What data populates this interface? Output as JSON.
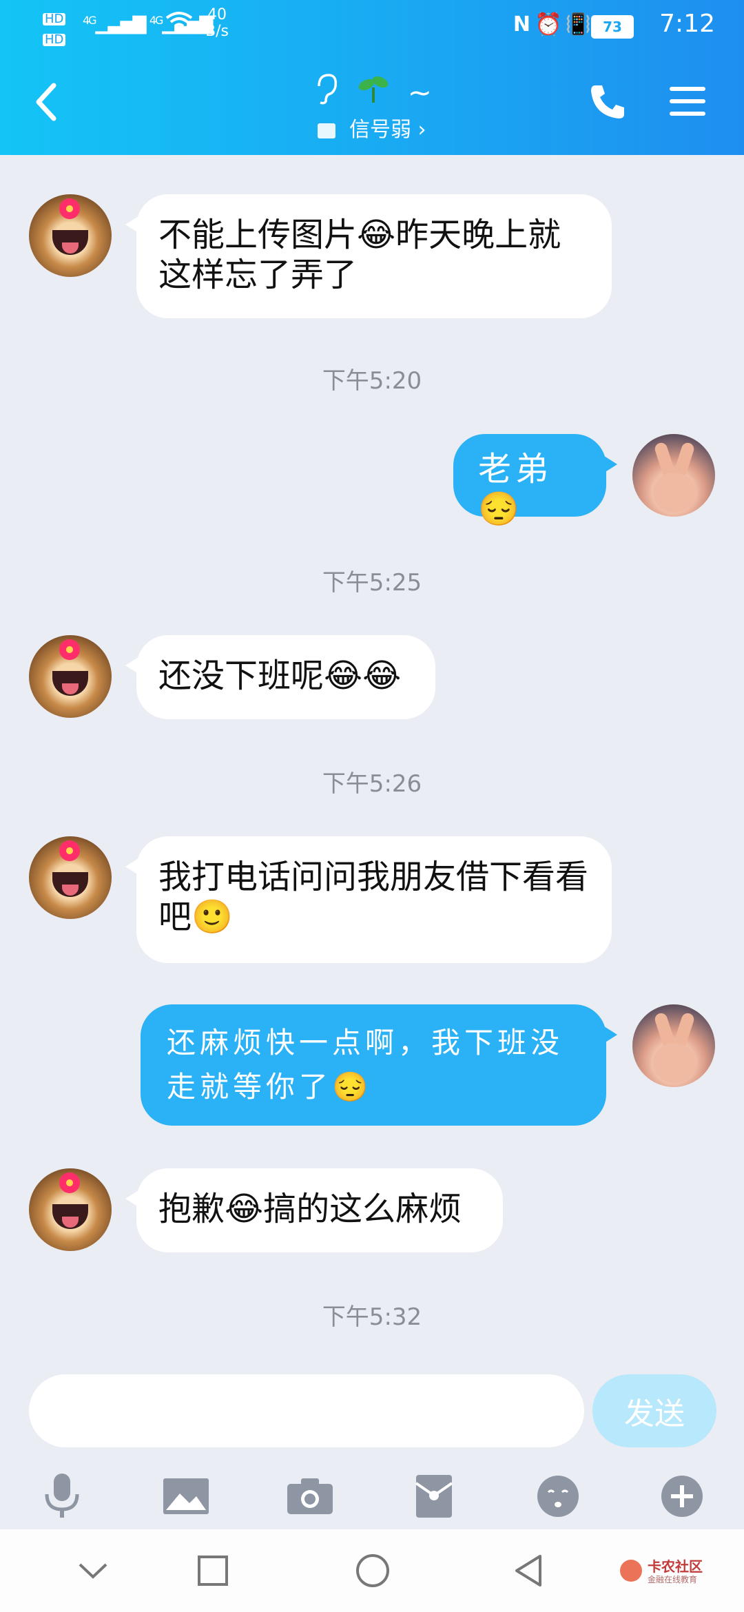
{
  "status_bar": {
    "sim1": "HD",
    "sim2": "HD",
    "network": "4G",
    "speed_value": "40",
    "speed_unit": "B/s",
    "battery": "73",
    "time": "7:12"
  },
  "header": {
    "title": "~",
    "subtitle": "信号弱"
  },
  "messages": [
    {
      "side": "left",
      "text": "不能上传图片😂昨天晚上就这样忘了弄了"
    },
    {
      "timestamp": "下午5:20"
    },
    {
      "side": "right",
      "text": "老弟😔"
    },
    {
      "timestamp": "下午5:25"
    },
    {
      "side": "left",
      "text": "还没下班呢😂😂"
    },
    {
      "timestamp": "下午5:26"
    },
    {
      "side": "left",
      "text": "我打电话问问我朋友借下看看吧🙂"
    },
    {
      "side": "right",
      "text": "还麻烦快一点啊，我下班没走就等你了😔"
    },
    {
      "side": "left",
      "text": "抱歉😂搞的这么麻烦"
    },
    {
      "timestamp": "下午5:32"
    }
  ],
  "input": {
    "value": "",
    "send_label": "发送"
  },
  "toolbar": [
    "microphone-icon",
    "image-icon",
    "camera-icon",
    "red-packet-icon",
    "emoji-icon",
    "plus-icon"
  ],
  "watermark": {
    "title": "卡农社区",
    "subtitle": "金融在线教育"
  },
  "colors": {
    "header": "#1aa6f2",
    "outgoing_bubble": "#2bb1f5",
    "background": "#eaedf4"
  }
}
